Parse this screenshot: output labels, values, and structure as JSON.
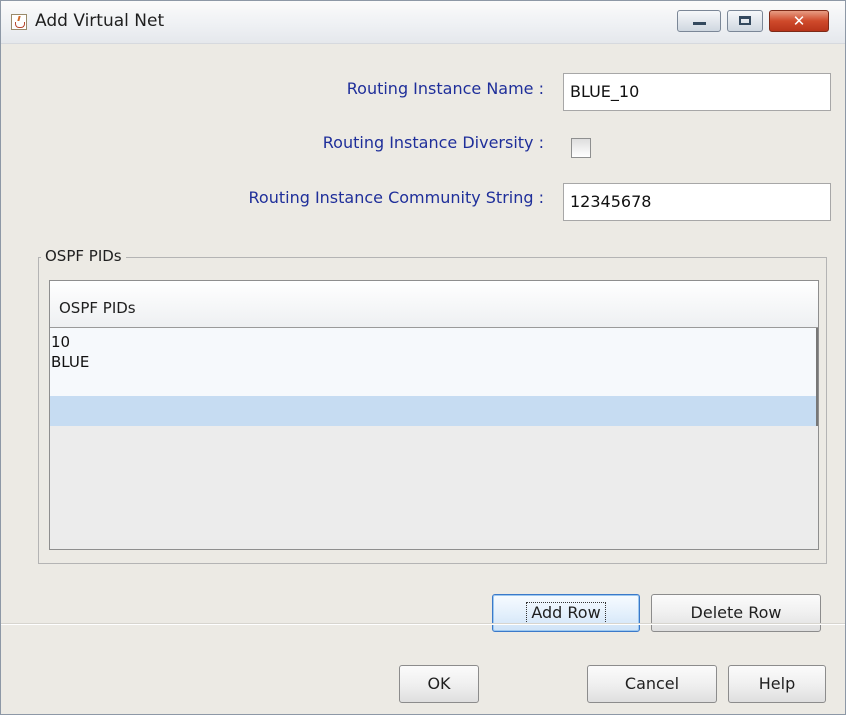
{
  "window": {
    "title": "Add Virtual Net",
    "controls": {
      "minimize": "minimize",
      "maximize": "maximize",
      "close": "close"
    }
  },
  "form": {
    "routing_instance_name": {
      "label": "Routing Instance Name :",
      "value": "BLUE_10"
    },
    "routing_instance_diversity": {
      "label": "Routing Instance Diversity :",
      "checked": false
    },
    "routing_instance_community_string": {
      "label": "Routing Instance Community String :",
      "value": "12345678"
    }
  },
  "ospf_group": {
    "title": "OSPF PIDs",
    "table": {
      "column_header": "OSPF PIDs",
      "rows": [
        "10",
        "BLUE",
        ""
      ],
      "selected_row_index": 2
    }
  },
  "buttons": {
    "add_row": "Add Row",
    "delete_row": "Delete Row",
    "ok": "OK",
    "cancel": "Cancel",
    "help": "Help"
  },
  "icons": {
    "app": "java-icon",
    "minimize": "minimize-icon",
    "maximize": "maximize-icon",
    "close": "close-icon"
  },
  "colors": {
    "label_text": "#1f2f9a",
    "selection": "#c6dcf2",
    "close_button": "#cf4a2b",
    "dialog_background": "#eceae4"
  }
}
